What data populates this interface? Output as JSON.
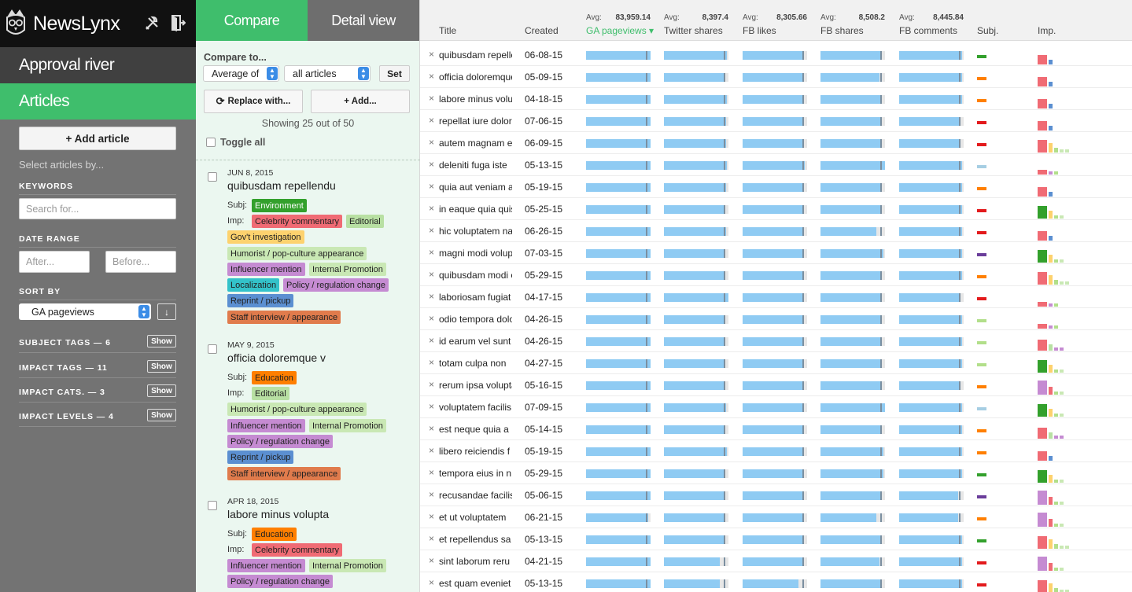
{
  "app": {
    "name": "NewsLynx"
  },
  "nav": {
    "river": "Approval river",
    "articles": "Articles"
  },
  "sidebar": {
    "add_article": "+ Add article",
    "select_hint": "Select articles by...",
    "keywords_label": "KEYWORDS",
    "search_placeholder": "Search for...",
    "date_range_label": "DATE RANGE",
    "after_placeholder": "After...",
    "before_placeholder": "Before...",
    "sort_label": "SORT BY",
    "sort_value": "GA pageviews",
    "sort_dir": "↓",
    "filters": [
      {
        "label": "SUBJECT TAGS — 6",
        "button": "Show"
      },
      {
        "label": "IMPACT TAGS — 11",
        "button": "Show"
      },
      {
        "label": "IMPACT CATS. — 3",
        "button": "Show"
      },
      {
        "label": "IMPACT LEVELS — 4",
        "button": "Show"
      }
    ]
  },
  "compare": {
    "tab_compare": "Compare",
    "tab_detail": "Detail view",
    "compare_to": "Compare to...",
    "agg": "Average of",
    "group": "all articles",
    "set": "Set",
    "replace": "Replace with...",
    "add": "+ Add...",
    "showing": "Showing 25 out of 50",
    "toggle_all": "Toggle all"
  },
  "cards": [
    {
      "date": "JUN 8, 2015",
      "title": "quibusdam repellendu",
      "subj_label": "Subj:",
      "imp_label": "Imp:",
      "subject": {
        "text": "Environment",
        "bg": "#33a02c",
        "fg": "#ffffff"
      },
      "tags": [
        {
          "text": "Celebrity commentary",
          "bg": "#f06b74",
          "fg": "#222"
        },
        {
          "text": "Editorial",
          "bg": "#b8e0a3",
          "fg": "#222"
        },
        {
          "text": "Gov't investigation",
          "bg": "#fdd26e",
          "fg": "#222"
        },
        {
          "text": "Humorist / pop-culture appearance",
          "bg": "#c9e8b4",
          "fg": "#222"
        },
        {
          "text": "Influencer mention",
          "bg": "#c58bd2",
          "fg": "#222"
        },
        {
          "text": "Internal Promotion",
          "bg": "#c9e8b4",
          "fg": "#222"
        },
        {
          "text": "Localization",
          "bg": "#33c2c9",
          "fg": "#222"
        },
        {
          "text": "Policy / regulation change",
          "bg": "#c58bd2",
          "fg": "#222"
        },
        {
          "text": "Reprint / pickup",
          "bg": "#5b8fd1",
          "fg": "#222"
        },
        {
          "text": "Staff interview / appearance",
          "bg": "#e07b4c",
          "fg": "#222"
        }
      ]
    },
    {
      "date": "MAY 9, 2015",
      "title": "officia doloremque v",
      "subj_label": "Subj:",
      "imp_label": "Imp:",
      "subject": {
        "text": "Education",
        "bg": "#ff7f00",
        "fg": "#222"
      },
      "tags": [
        {
          "text": "Editorial",
          "bg": "#b8e0a3",
          "fg": "#222"
        },
        {
          "text": "Humorist / pop-culture appearance",
          "bg": "#c9e8b4",
          "fg": "#222"
        },
        {
          "text": "Influencer mention",
          "bg": "#c58bd2",
          "fg": "#222"
        },
        {
          "text": "Internal Promotion",
          "bg": "#c9e8b4",
          "fg": "#222"
        },
        {
          "text": "Policy / regulation change",
          "bg": "#c58bd2",
          "fg": "#222"
        },
        {
          "text": "Reprint / pickup",
          "bg": "#5b8fd1",
          "fg": "#222"
        },
        {
          "text": "Staff interview / appearance",
          "bg": "#e07b4c",
          "fg": "#222"
        }
      ]
    },
    {
      "date": "APR 18, 2015",
      "title": "labore minus volupta",
      "subj_label": "Subj:",
      "imp_label": "Imp:",
      "subject": {
        "text": "Education",
        "bg": "#ff7f00",
        "fg": "#222"
      },
      "tags": [
        {
          "text": "Celebrity commentary",
          "bg": "#f06b74",
          "fg": "#222"
        },
        {
          "text": "Influencer mention",
          "bg": "#c58bd2",
          "fg": "#222"
        },
        {
          "text": "Internal Promotion",
          "bg": "#c9e8b4",
          "fg": "#222"
        },
        {
          "text": "Policy / regulation change",
          "bg": "#c58bd2",
          "fg": "#222"
        }
      ]
    }
  ],
  "table": {
    "headers": {
      "title": "Title",
      "created": "Created",
      "subj": "Subj.",
      "imp": "Imp."
    },
    "metrics": [
      {
        "name": "GA pageviews ▾",
        "avg_label": "Avg:",
        "avg": "83,959.14"
      },
      {
        "name": "Twitter shares",
        "avg_label": "Avg:",
        "avg": "8,397.4"
      },
      {
        "name": "FB likes",
        "avg_label": "Avg:",
        "avg": "8,305.66"
      },
      {
        "name": "FB shares",
        "avg_label": "Avg:",
        "avg": "8,508.2"
      },
      {
        "name": "FB comments",
        "avg_label": "Avg:",
        "avg": "8,445.84"
      }
    ],
    "rows": [
      {
        "title": "quibusdam repellendu",
        "created": "06-08-15",
        "subj": "#33a02c",
        "bars": [
          1,
          0.97,
          0.95,
          0.93,
          0.98
        ],
        "imp": 3
      },
      {
        "title": "officia doloremque v",
        "created": "05-09-15",
        "subj": "#ff7f00",
        "bars": [
          1,
          0.95,
          0.93,
          0.92,
          0.98
        ],
        "imp": 2
      },
      {
        "title": "labore minus volupta",
        "created": "04-18-15",
        "subj": "#ff7f00",
        "bars": [
          1,
          0.97,
          0.93,
          0.95,
          0.98
        ],
        "imp": 1
      },
      {
        "title": "repellat iure dolore",
        "created": "07-06-15",
        "subj": "#e31a1c",
        "bars": [
          1,
          0.96,
          0.94,
          0.93,
          0.93
        ],
        "imp": 0
      },
      {
        "title": "autem magnam eos",
        "created": "06-09-15",
        "subj": "#e31a1c",
        "bars": [
          1,
          0.96,
          0.94,
          0.93,
          0.93
        ],
        "imp": 2
      },
      {
        "title": "deleniti fuga iste",
        "created": "05-13-15",
        "subj": "#a6cee3",
        "bars": [
          1,
          0.97,
          0.96,
          1,
          0.98
        ],
        "imp": 3
      },
      {
        "title": "quia aut veniam a",
        "created": "05-19-15",
        "subj": "#ff7f00",
        "bars": [
          1,
          0.96,
          0.93,
          0.95,
          0.98
        ],
        "imp": 3
      },
      {
        "title": "in eaque quia quis",
        "created": "05-25-15",
        "subj": "#e31a1c",
        "bars": [
          1,
          0.95,
          0.95,
          0.95,
          0.98
        ],
        "imp": 3
      },
      {
        "title": "hic voluptatem natus",
        "created": "06-26-15",
        "subj": "#e31a1c",
        "bars": [
          1,
          0.96,
          0.95,
          0.87,
          0.98
        ],
        "imp": 1
      },
      {
        "title": "magni modi volupta",
        "created": "07-03-15",
        "subj": "#6a3d9a",
        "bars": [
          1,
          0.95,
          0.95,
          0.97,
          0.98
        ],
        "imp": 1
      },
      {
        "title": "quibusdam modi et",
        "created": "05-29-15",
        "subj": "#ff7f00",
        "bars": [
          1,
          0.95,
          0.95,
          0.93,
          0.98
        ],
        "imp": 2
      },
      {
        "title": "laboriosam fugiat",
        "created": "04-17-15",
        "subj": "#e31a1c",
        "bars": [
          1,
          1,
          0.95,
          0.95,
          0.93
        ],
        "imp": 3
      },
      {
        "title": "odio tempora dolor",
        "created": "04-26-15",
        "subj": "#b2df8a",
        "bars": [
          1,
          0.95,
          0.95,
          0.95,
          0.98
        ],
        "imp": 2
      },
      {
        "title": "id earum vel sunt",
        "created": "04-26-15",
        "subj": "#b2df8a",
        "bars": [
          1,
          0.95,
          0.93,
          0.95,
          0.98
        ],
        "imp": 0
      },
      {
        "title": "totam culpa non",
        "created": "04-27-15",
        "subj": "#b2df8a",
        "bars": [
          1,
          0.95,
          0.93,
          0.95,
          0.98
        ],
        "imp": 2
      },
      {
        "title": "rerum ipsa volupta",
        "created": "05-16-15",
        "subj": "#ff7f00",
        "bars": [
          1,
          0.95,
          0.93,
          0.95,
          0.93
        ],
        "imp": 2
      },
      {
        "title": "voluptatem facilis",
        "created": "07-09-15",
        "subj": "#a6cee3",
        "bars": [
          1,
          0.96,
          0.95,
          1,
          0.98
        ],
        "imp": 0
      },
      {
        "title": "est neque quia a",
        "created": "05-14-15",
        "subj": "#ff7f00",
        "bars": [
          1,
          0.93,
          0.95,
          0.95,
          0.98
        ],
        "imp": 2
      },
      {
        "title": "libero reiciendis f",
        "created": "05-19-15",
        "subj": "#ff7f00",
        "bars": [
          1,
          0.97,
          0.93,
          0.97,
          0.98
        ],
        "imp": 3
      },
      {
        "title": "tempora eius in n",
        "created": "05-29-15",
        "subj": "#33a02c",
        "bars": [
          1,
          0.95,
          0.93,
          0.97,
          0.98
        ],
        "imp": 3
      },
      {
        "title": "recusandae facilis",
        "created": "05-06-15",
        "subj": "#6a3d9a",
        "bars": [
          1,
          0.95,
          0.93,
          0.95,
          0.92
        ],
        "imp": 3
      },
      {
        "title": "et ut voluptatem",
        "created": "06-21-15",
        "subj": "#ff7f00",
        "bars": [
          0.96,
          0.95,
          0.93,
          0.87,
          0.92
        ],
        "imp": 2
      },
      {
        "title": "et repellendus sa",
        "created": "05-13-15",
        "subj": "#33a02c",
        "bars": [
          1,
          0.95,
          0.95,
          0.95,
          0.98
        ],
        "imp": 2
      },
      {
        "title": "sint laborum reru",
        "created": "04-21-15",
        "subj": "#e31a1c",
        "bars": [
          1,
          0.87,
          0.93,
          0.92,
          0.98
        ],
        "imp": 0
      },
      {
        "title": "est quam eveniet",
        "created": "05-13-15",
        "subj": "#e31a1c",
        "bars": [
          1,
          0.86,
          0.87,
          0.95,
          0.98
        ],
        "imp": 0
      }
    ]
  },
  "colors": {
    "green": "#3fbe6c",
    "bar": "#8fcbf3",
    "dark": "#111111",
    "sidebar": "#737373"
  }
}
